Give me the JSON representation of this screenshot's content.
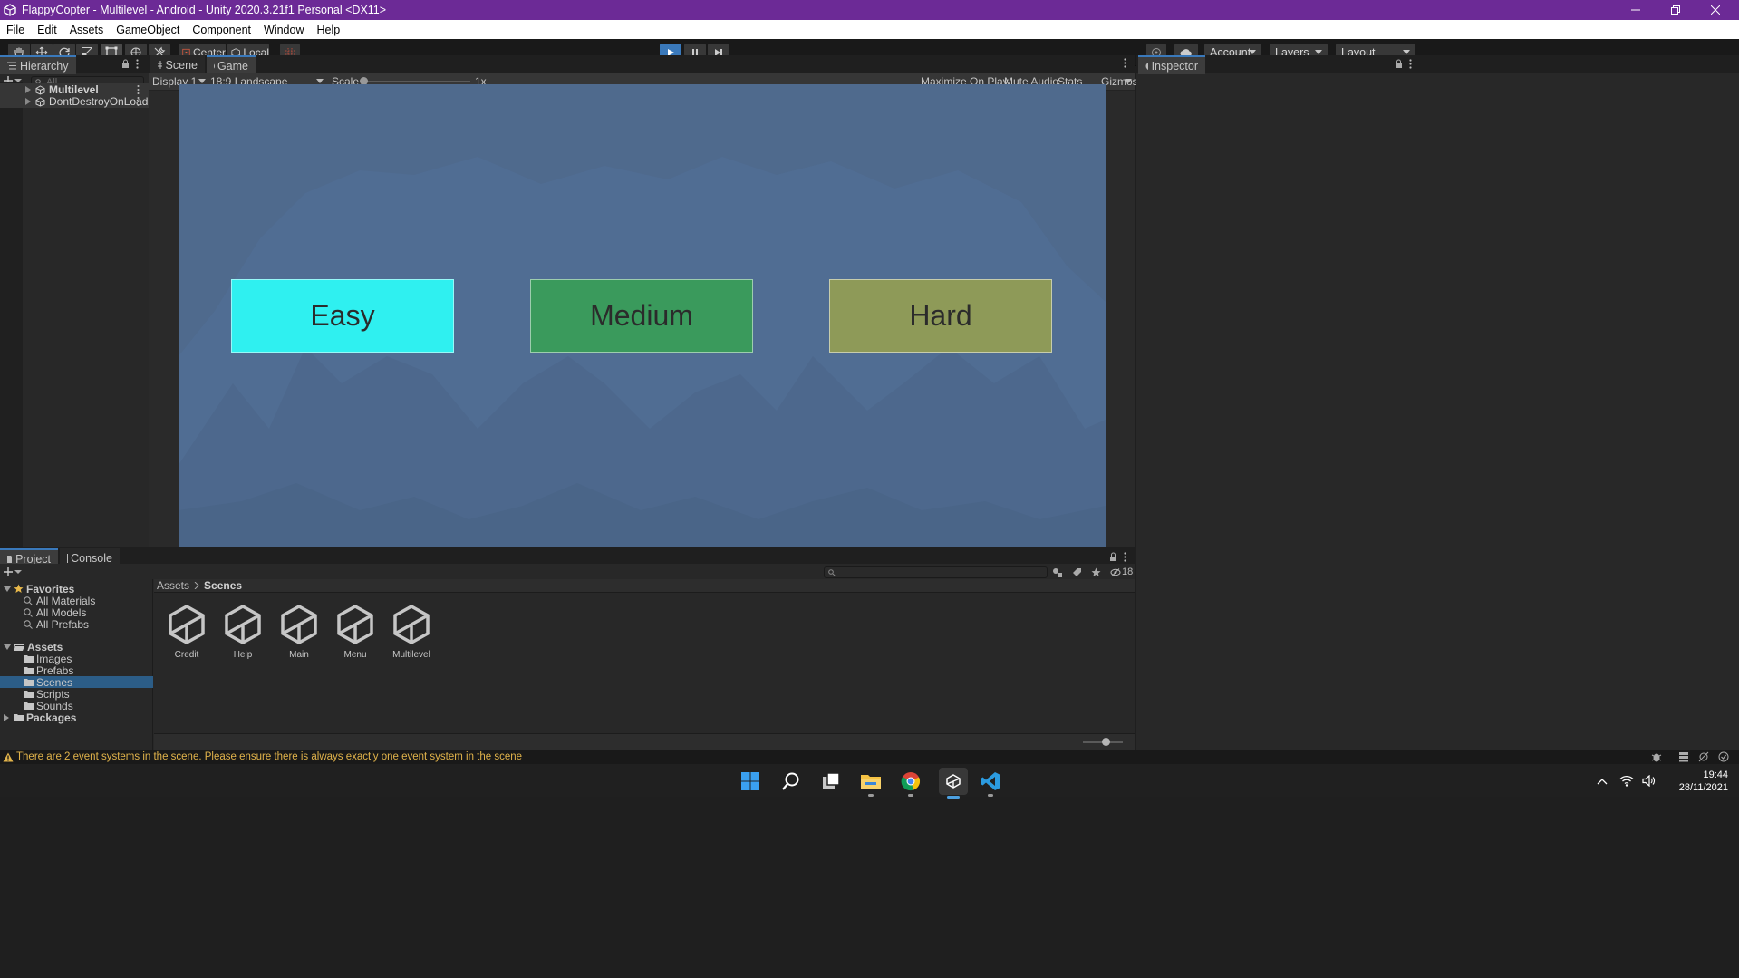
{
  "window": {
    "title": "FlappyCopter - Multilevel - Android - Unity 2020.3.21f1 Personal <DX11>",
    "titlebar_color": "#6c2a96"
  },
  "menu": [
    "File",
    "Edit",
    "Assets",
    "GameObject",
    "Component",
    "Window",
    "Help"
  ],
  "toolbar": {
    "pivot_center_label": "Center",
    "pivot_local_label": "Local",
    "account_label": "Account",
    "layers_label": "Layers",
    "layout_label": "Layout",
    "play_active_color": "#3a79bb"
  },
  "hierarchy": {
    "tab_label": "Hierarchy",
    "search_placeholder": "All",
    "items": [
      "Multilevel",
      "DontDestroyOnLoad"
    ]
  },
  "game_view": {
    "tabs": [
      "Scene",
      "Game"
    ],
    "display_label": "Display 1",
    "aspect_label": "18:9 Landscape",
    "scale_label": "Scale",
    "scale_value": "1x",
    "maximize_label": "Maximize On Play",
    "mute_label": "Mute Audio",
    "stats_label": "Stats",
    "gizmos_label": "Gizmos",
    "background_color": "#4f6a8d",
    "buttons": [
      {
        "label": "Easy",
        "color": "#2ff0f0"
      },
      {
        "label": "Medium",
        "color": "#3a9a5c"
      },
      {
        "label": "Hard",
        "color": "#8e9a58"
      }
    ]
  },
  "inspector": {
    "tab_label": "Inspector"
  },
  "project": {
    "tabs": [
      "Project",
      "Console"
    ],
    "favorites_label": "Favorites",
    "favorites": [
      "All Materials",
      "All Models",
      "All Prefabs"
    ],
    "assets_label": "Assets",
    "asset_folders": [
      "Images",
      "Prefabs",
      "Scenes",
      "Scripts",
      "Sounds"
    ],
    "selected_folder": "Scenes",
    "packages_label": "Packages",
    "breadcrumb": [
      "Assets",
      "Scenes"
    ],
    "scene_files": [
      "Credit",
      "Help",
      "Main",
      "Menu",
      "Multilevel"
    ],
    "hidden_count": "18"
  },
  "status": {
    "warning": "There are 2 event systems in the scene. Please ensure there is always exactly one event system in the scene"
  },
  "taskbar": {
    "time": "19:44",
    "date": "28/11/2021"
  }
}
